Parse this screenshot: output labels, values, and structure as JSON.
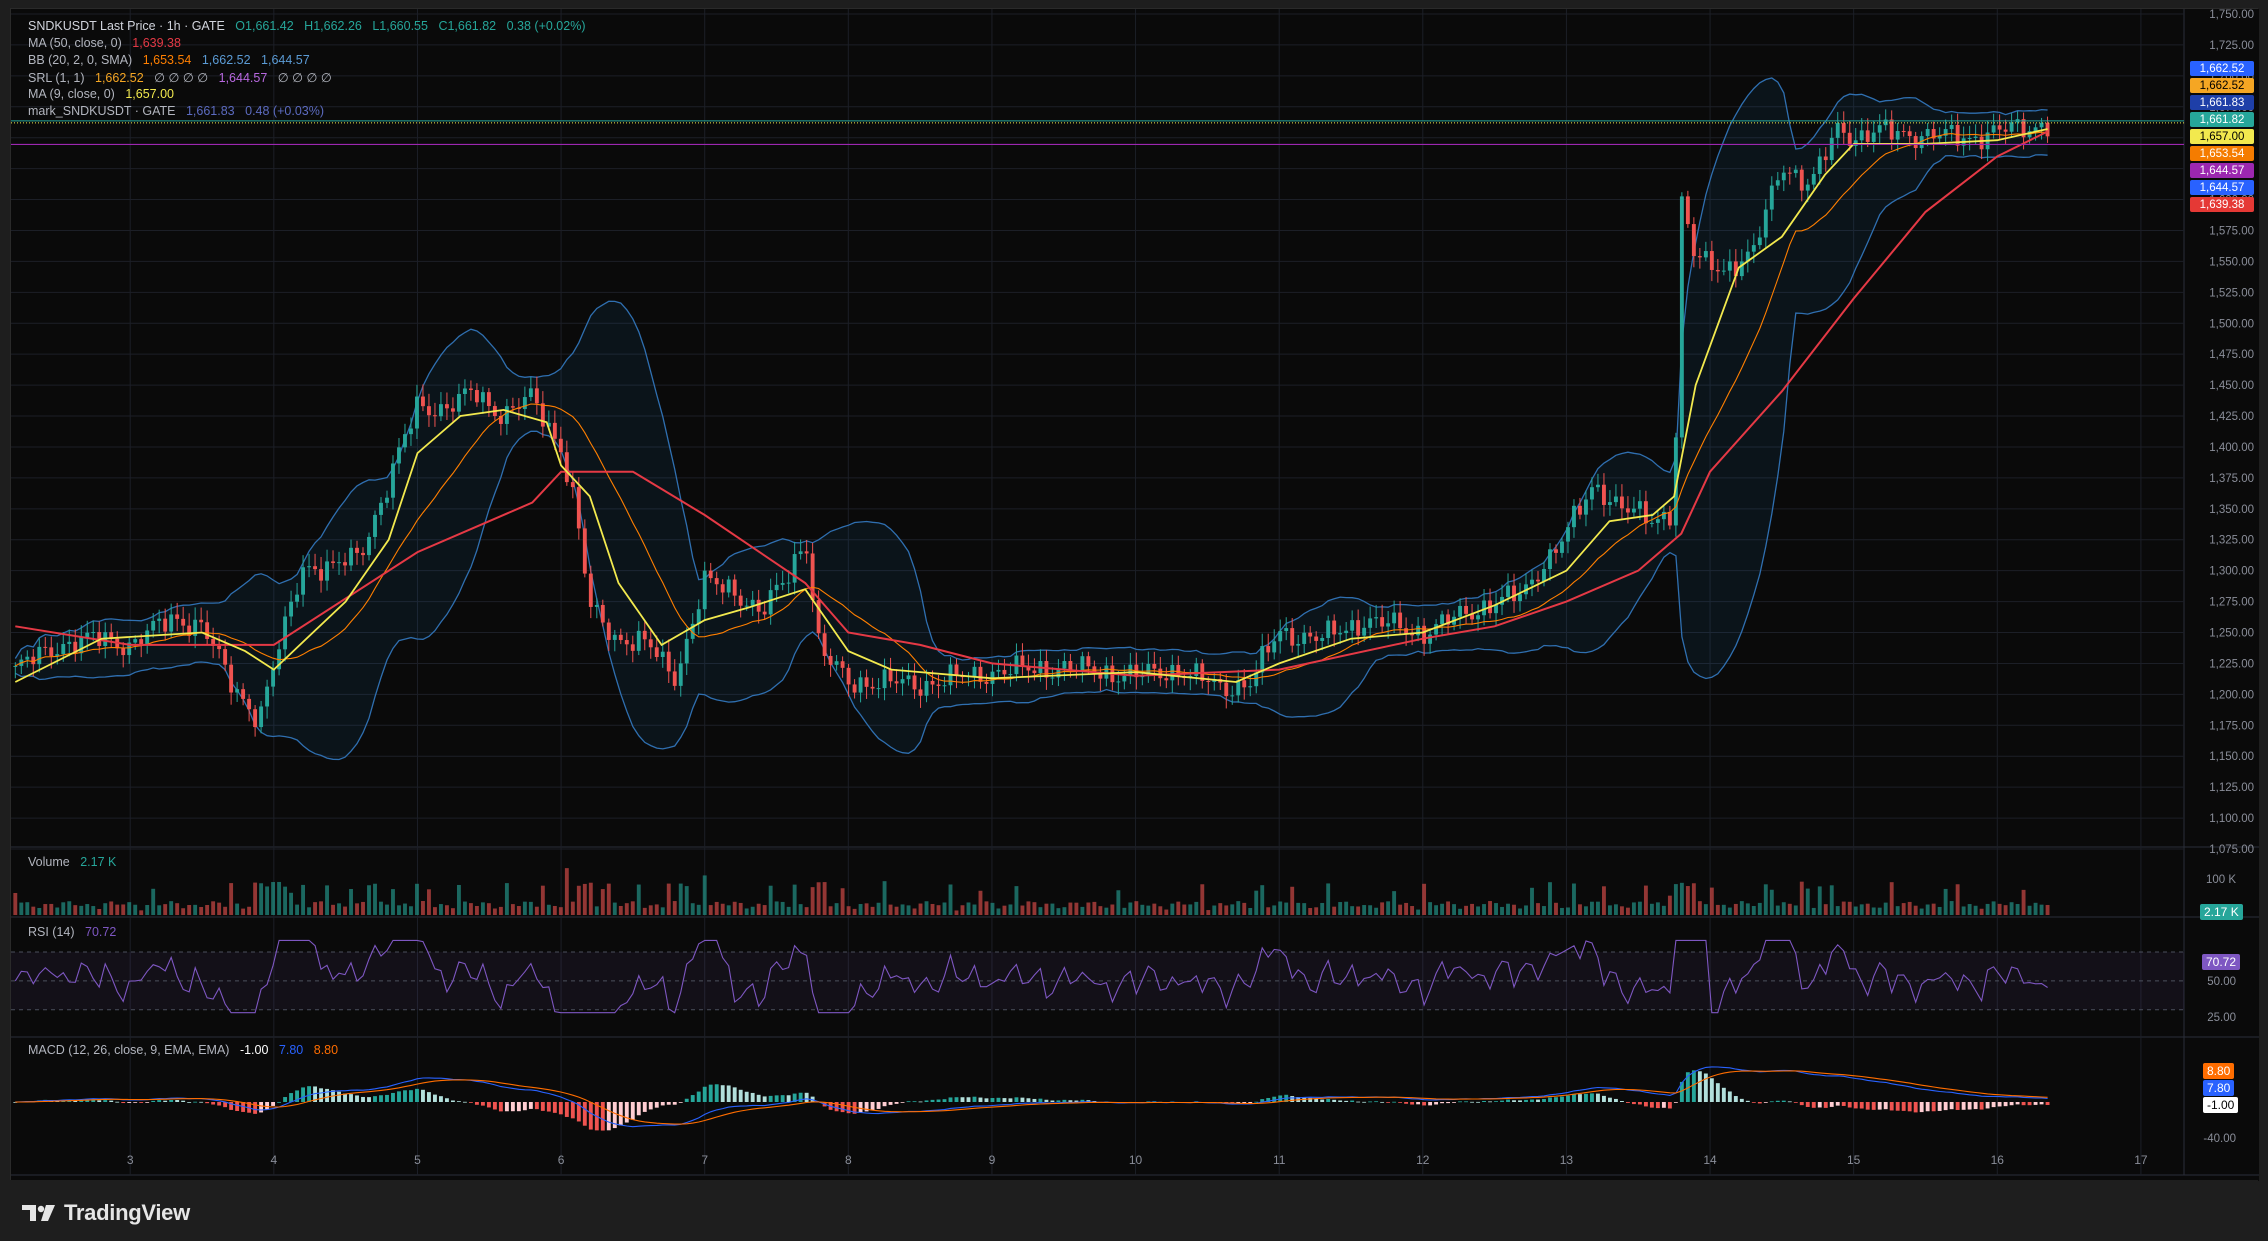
{
  "app": "TradingView",
  "symbol_header": {
    "symbol": "SNDKUSDT Last Price · 1h · GATE",
    "open": "O1,661.42",
    "high": "H1,662.26",
    "low": "L1,660.55",
    "close": "C1,661.82",
    "change": "0.38 (+0.02%)"
  },
  "indicators": {
    "ma50": {
      "label": "MA (50, close, 0)",
      "value": "1,639.38"
    },
    "bb": {
      "label": "BB (20, 2, 0, SMA)",
      "basis": "1,653.54",
      "upper": "1,662.52",
      "lower": "1,644.57"
    },
    "srl": {
      "label": "SRL (1, 1)",
      "v1": "1,662.52",
      "dots1": "∅ ∅ ∅ ∅",
      "v2": "1,644.57",
      "dots2": "∅ ∅ ∅ ∅"
    },
    "ma9": {
      "label": "MA (9, close, 0)",
      "value": "1,657.00"
    },
    "mark": {
      "label": "mark_SNDKUSDT · GATE",
      "value": "1,661.83",
      "change": "0.48 (+0.03%)"
    }
  },
  "volume_pane": {
    "label": "Volume",
    "value": "2.17 K",
    "axis": [
      "100 K"
    ],
    "tag": "2.17 K"
  },
  "rsi_pane": {
    "label": "RSI (14)",
    "value": "70.72",
    "axis": [
      "50.00",
      "25.00"
    ],
    "tag": "70.72"
  },
  "macd_pane": {
    "label": "MACD (12, 26, close, 9, EMA, EMA)",
    "hist": "-1.00",
    "macd": "7.80",
    "signal": "8.80",
    "axis": [
      "-40.00"
    ],
    "tags": [
      "8.80",
      "7.80",
      "-1.00"
    ]
  },
  "price_tags": [
    {
      "text": "1,662.52",
      "color": "#2962ff"
    },
    {
      "text": "1,662.52",
      "color": "#f5a623"
    },
    {
      "text": "1,661.83",
      "color": "#1e3fa8"
    },
    {
      "text": "1,661.82",
      "color": "#26a69a"
    },
    {
      "text": "1,657.00",
      "color": "#f2e94e"
    },
    {
      "text": "1,653.54",
      "color": "#f57c00"
    },
    {
      "text": "1,644.57",
      "color": "#9c27b0"
    },
    {
      "text": "1,644.57",
      "color": "#2962ff"
    },
    {
      "text": "1,639.38",
      "color": "#e53935"
    }
  ],
  "colors": {
    "up": "#26a69a",
    "down": "#ef5350",
    "ma9": "#f2e94e",
    "ma50": "#e53945",
    "bb_basis": "#ff7f00",
    "bb_band": "#2f6fb0",
    "rsi": "#7e57c2",
    "macd": "#2962ff",
    "signal": "#ff6d00"
  },
  "chart_data": {
    "type": "line",
    "title": "SNDKUSDT Last Price · 1h · GATE",
    "ylim": [
      1075,
      1750
    ],
    "y_ticks": [
      "1,750.00",
      "1,725.00",
      "1,700.00",
      "1,675.00",
      "1,650.00",
      "1,625.00",
      "1,600.00",
      "1,575.00",
      "1,550.00",
      "1,525.00",
      "1,500.00",
      "1,475.00",
      "1,450.00",
      "1,425.00",
      "1,400.00",
      "1,375.00",
      "1,350.00",
      "1,325.00",
      "1,300.00",
      "1,275.00",
      "1,250.00",
      "1,225.00",
      "1,200.00",
      "1,175.00",
      "1,150.00",
      "1,125.00",
      "1,100.00",
      "1,075.00"
    ],
    "x_ticks": [
      "3",
      "4",
      "5",
      "6",
      "7",
      "8",
      "9",
      "10",
      "11",
      "12",
      "13",
      "14",
      "15",
      "16",
      "17"
    ],
    "x_domain": [
      2.17,
      17.3
    ],
    "series": [
      {
        "name": "Price",
        "x": [
          2.2,
          2.5,
          2.8,
          3.0,
          3.3,
          3.5,
          3.7,
          3.9,
          4.2,
          4.4,
          4.6,
          4.8,
          5.0,
          5.2,
          5.4,
          5.6,
          5.8,
          6.0,
          6.1,
          6.2,
          6.4,
          6.6,
          6.8,
          7.0,
          7.2,
          7.4,
          7.6,
          7.7,
          7.8,
          8.0,
          8.2,
          8.5,
          9.0,
          9.5,
          10.0,
          10.3,
          10.6,
          10.8,
          11.0,
          11.3,
          11.6,
          12.0,
          12.3,
          12.5,
          12.7,
          12.8,
          13.0,
          13.2,
          13.4,
          13.6,
          13.75,
          13.8,
          13.9,
          14.1,
          14.3,
          14.5,
          14.7,
          14.9,
          15.0,
          15.2,
          15.5,
          15.8,
          16.0,
          16.2,
          16.35
        ],
        "values": [
          1220,
          1240,
          1245,
          1240,
          1262,
          1255,
          1210,
          1180,
          1305,
          1300,
          1315,
          1370,
          1435,
          1430,
          1445,
          1425,
          1440,
          1400,
          1350,
          1270,
          1245,
          1240,
          1215,
          1290,
          1285,
          1265,
          1300,
          1330,
          1235,
          1210,
          1210,
          1208,
          1218,
          1222,
          1215,
          1220,
          1205,
          1210,
          1250,
          1245,
          1260,
          1250,
          1265,
          1275,
          1280,
          1300,
          1330,
          1370,
          1350,
          1340,
          1350,
          1600,
          1550,
          1545,
          1555,
          1630,
          1610,
          1660,
          1650,
          1655,
          1652,
          1650,
          1655,
          1658,
          1662
        ]
      },
      {
        "name": "MA (50, close, 0)",
        "x": [
          2.2,
          3.0,
          4.0,
          5.0,
          5.8,
          6.0,
          6.5,
          7.0,
          7.7,
          8.0,
          8.5,
          9.0,
          10.0,
          11.0,
          12.0,
          12.5,
          13.0,
          13.5,
          13.8,
          14.0,
          14.5,
          15.0,
          15.5,
          16.0,
          16.35
        ],
        "values": [
          1255,
          1240,
          1240,
          1315,
          1355,
          1380,
          1380,
          1345,
          1290,
          1250,
          1240,
          1225,
          1215,
          1220,
          1245,
          1255,
          1275,
          1300,
          1330,
          1380,
          1445,
          1520,
          1590,
          1635,
          1655
        ]
      },
      {
        "name": "MA (9, close, 0)",
        "x": [
          2.2,
          2.8,
          3.5,
          3.8,
          4.0,
          4.5,
          4.8,
          5.0,
          5.3,
          5.6,
          5.9,
          6.0,
          6.2,
          6.4,
          6.7,
          7.0,
          7.3,
          7.7,
          8.0,
          8.3,
          9.0,
          10.0,
          10.7,
          11.0,
          11.5,
          12.0,
          12.5,
          13.0,
          13.3,
          13.6,
          13.75,
          13.9,
          14.2,
          14.5,
          14.8,
          15.0,
          15.5,
          16.0,
          16.35
        ],
        "values": [
          1210,
          1245,
          1250,
          1235,
          1220,
          1275,
          1325,
          1395,
          1425,
          1430,
          1420,
          1385,
          1360,
          1290,
          1240,
          1260,
          1270,
          1285,
          1235,
          1220,
          1213,
          1218,
          1210,
          1225,
          1245,
          1250,
          1272,
          1300,
          1340,
          1345,
          1360,
          1450,
          1545,
          1570,
          1620,
          1645,
          1645,
          1648,
          1657
        ]
      }
    ]
  }
}
